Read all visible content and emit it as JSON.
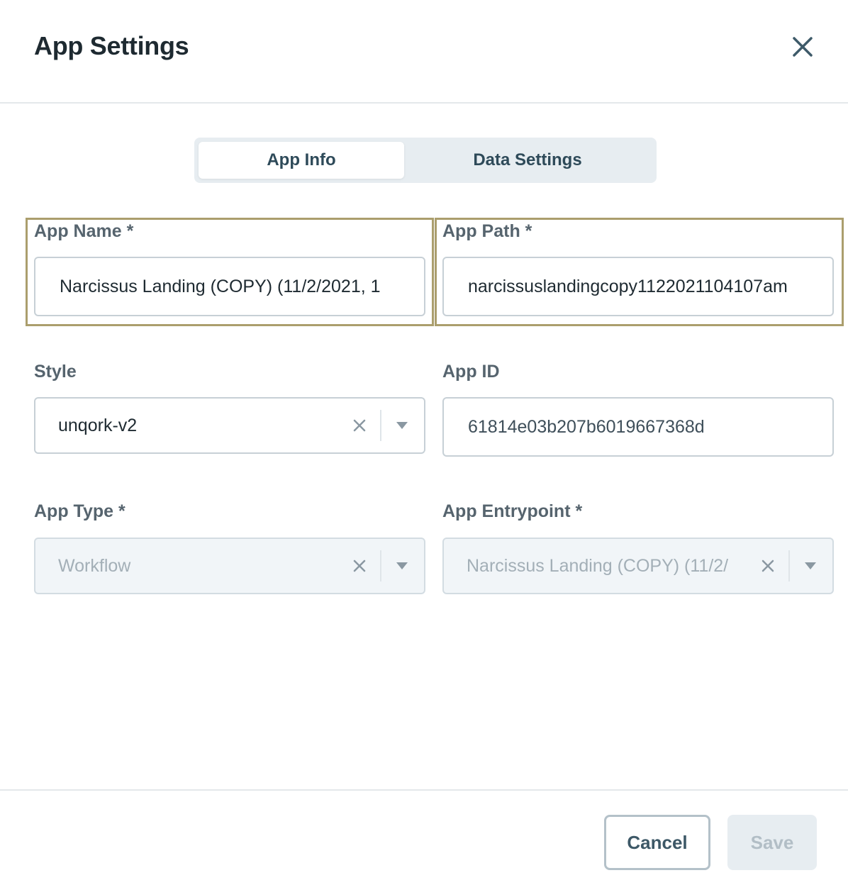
{
  "dialog": {
    "title": "App Settings",
    "close_icon": "close-icon"
  },
  "tabs": [
    {
      "label": "App Info",
      "active": true
    },
    {
      "label": "Data Settings",
      "active": false
    }
  ],
  "fields": {
    "app_name": {
      "label": "App Name *",
      "value": "Narcissus Landing (COPY) (11/2/2021, 1"
    },
    "app_path": {
      "label": "App Path *",
      "value": "narcissuslandingcopy1122021104107am"
    },
    "style": {
      "label": "Style",
      "value": "unqork-v2"
    },
    "app_id": {
      "label": "App ID",
      "value": "61814e03b207b6019667368d"
    },
    "app_type": {
      "label": "App Type *",
      "value": "Workflow"
    },
    "app_entrypoint": {
      "label": "App Entrypoint *",
      "value": "Narcissus Landing (COPY) (11/2/"
    }
  },
  "footer": {
    "cancel_label": "Cancel",
    "save_label": "Save"
  },
  "colors": {
    "highlight_border": "#ab9e6d",
    "text_primary": "#1e2a31",
    "tab_track": "#e7edf1"
  }
}
